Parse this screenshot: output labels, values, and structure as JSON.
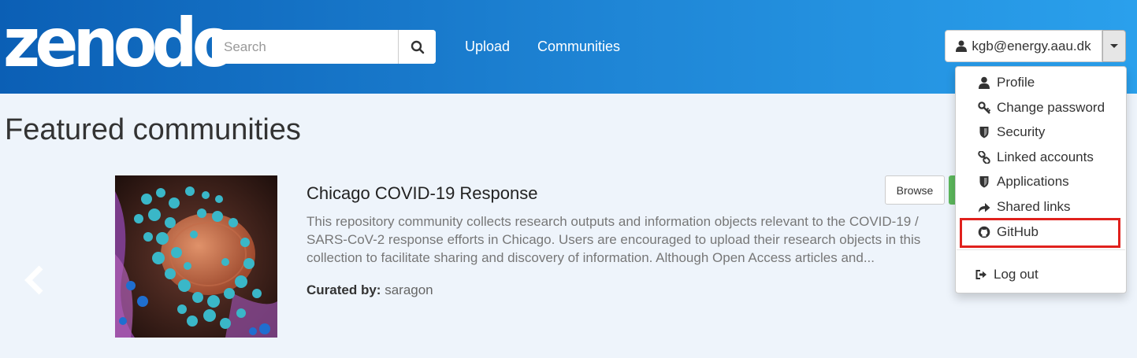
{
  "brand": {
    "logo_text": "zenodo"
  },
  "search": {
    "placeholder": "Search"
  },
  "nav": {
    "upload_label": "Upload",
    "communities_label": "Communities"
  },
  "user": {
    "email": "kgb@energy.aau.dk"
  },
  "page": {
    "title": "Featured communities"
  },
  "community": {
    "title": "Chicago COVID-19 Response",
    "browse_label": "Browse",
    "description": "This repository community collects research outputs and information objects relevant to the COVID-19 / SARS-CoV-2 response efforts in Chicago. Users are encouraged to upload their research objects in this collection to facilitate sharing and discovery of information. Although Open Access articles and...",
    "curated_label": "Curated by:",
    "curator": "saragon"
  },
  "user_menu": {
    "items": [
      {
        "label": "Profile",
        "icon": "user-icon"
      },
      {
        "label": "Change password",
        "icon": "key-icon"
      },
      {
        "label": "Security",
        "icon": "shield-icon"
      },
      {
        "label": "Linked accounts",
        "icon": "link-icon"
      },
      {
        "label": "Applications",
        "icon": "shield-icon"
      },
      {
        "label": "Shared links",
        "icon": "share-icon"
      },
      {
        "label": "GitHub",
        "icon": "github-icon"
      }
    ],
    "logout_label": "Log out"
  },
  "colors": {
    "navbar_start": "#0b5fb5",
    "navbar_end": "#2aa0ec",
    "highlight": "#e0211d",
    "submit_green": "#5cb85c"
  }
}
